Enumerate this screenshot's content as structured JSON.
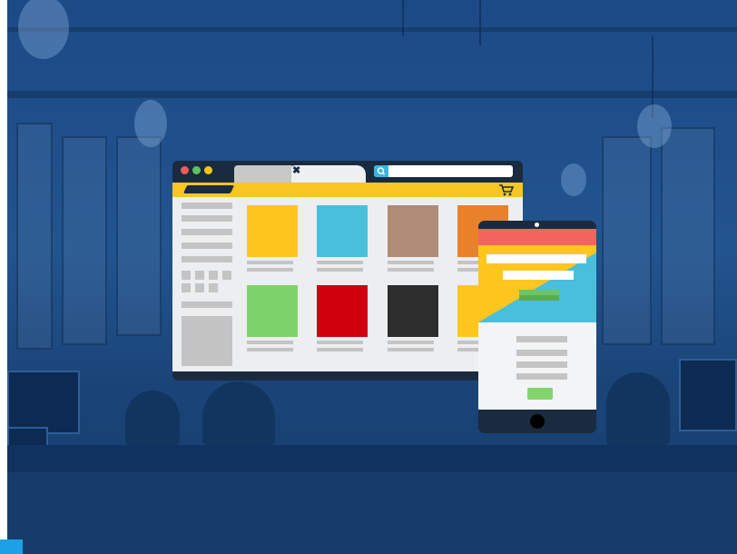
{
  "scene": {
    "description_icons": [
      "office-background"
    ],
    "colors": {
      "overlay": "#1c4a86",
      "corner_badge": "#1da1e6"
    }
  },
  "browser": {
    "window_controls": [
      {
        "name": "close",
        "color": "#f05a5a"
      },
      {
        "name": "maximize",
        "color": "#5cc45c"
      },
      {
        "name": "minimize",
        "color": "#f5c518"
      }
    ],
    "tab_close_glyph": "✖",
    "search_icon": "search-icon",
    "toolbar_color": "#f9c623",
    "cart_icon": "cart-icon",
    "products": [
      {
        "color": "#ffc61f"
      },
      {
        "color": "#49bfdc"
      },
      {
        "color": "#ae8c77"
      },
      {
        "color": "#e8822a"
      },
      {
        "color": "#7ed36c"
      },
      {
        "color": "#d0000f"
      },
      {
        "color": "#2d2d2d"
      },
      {
        "color": "#ffc61f"
      }
    ]
  },
  "tablet": {
    "header_color": "#f4645e",
    "hero_colors": [
      "#ffc61f",
      "#49bfdc"
    ],
    "button_color": "#82d46f"
  }
}
